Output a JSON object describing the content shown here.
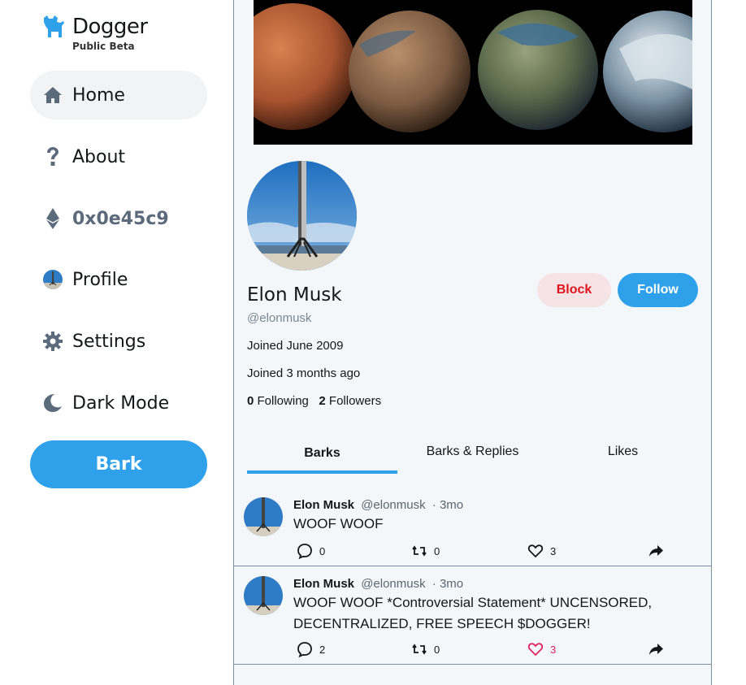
{
  "brand": {
    "name": "Dogger",
    "subtitle": "Public Beta",
    "color": "#2fa0ea"
  },
  "sidebar": {
    "items": [
      {
        "label": "Home",
        "icon": "home-icon",
        "active": true
      },
      {
        "label": "About",
        "icon": "question-icon"
      },
      {
        "label": "0x0e45c9",
        "icon": "ethereum-icon"
      },
      {
        "label": "Profile",
        "icon": "avatar-icon"
      },
      {
        "label": "Settings",
        "icon": "gear-icon"
      },
      {
        "label": "Dark Mode",
        "icon": "moon-icon"
      }
    ],
    "bark_button": "Bark"
  },
  "profile": {
    "name": "Elon Musk",
    "handle": "@elonmusk",
    "joined": "Joined June 2009",
    "joined_relative": "Joined 3 months ago",
    "following_count": "0",
    "following_label": "Following",
    "followers_count": "2",
    "followers_label": "Followers",
    "block_label": "Block",
    "follow_label": "Follow"
  },
  "tabs": [
    {
      "label": "Barks",
      "active": true
    },
    {
      "label": "Barks & Replies"
    },
    {
      "label": "Likes"
    }
  ],
  "posts": [
    {
      "name": "Elon Musk",
      "handle": "@elonmusk",
      "time": "· 3mo",
      "text": "WOOF WOOF",
      "replies": "0",
      "rebarks": "0",
      "likes": "3",
      "liked": false
    },
    {
      "name": "Elon Musk",
      "handle": "@elonmusk",
      "time": "· 3mo",
      "text": "WOOF WOOF *Controversial Statement* UNCENSORED, DECENTRALIZED, FREE SPEECH $DOGGER!",
      "replies": "2",
      "rebarks": "0",
      "likes": "3",
      "liked": true
    }
  ],
  "colors": {
    "accent": "#2fa0ea",
    "danger": "#e0141e",
    "like": "#e0245e"
  }
}
